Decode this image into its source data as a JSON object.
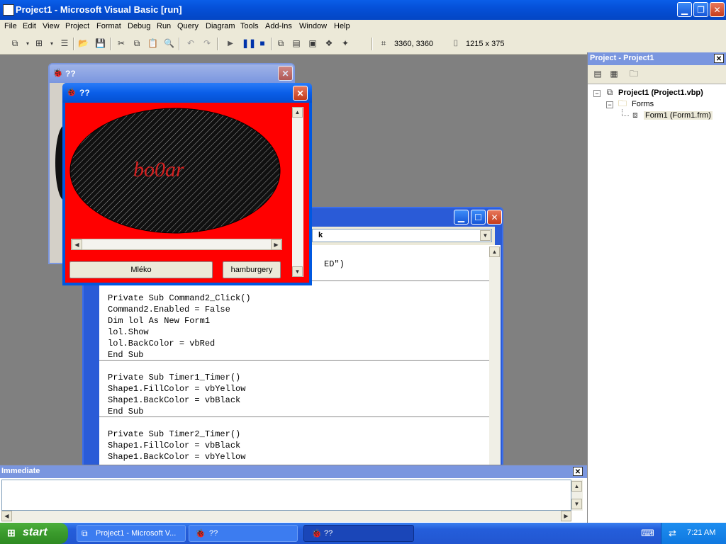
{
  "window": {
    "title": "Project1 - Microsoft Visual Basic [run]"
  },
  "menu": {
    "items": [
      "File",
      "Edit",
      "View",
      "Project",
      "Format",
      "Debug",
      "Run",
      "Query",
      "Diagram",
      "Tools",
      "Add-Ins",
      "Window",
      "Help"
    ]
  },
  "toolbar": {
    "position_readout": "3360, 3360",
    "size_readout": "1215 x 375"
  },
  "project_panel": {
    "title": "Project - Project1",
    "root": "Project1 (Project1.vbp)",
    "folder": "Forms",
    "form": "Form1 (Form1.frm)"
  },
  "back_form": {
    "title": "??"
  },
  "front_form": {
    "title": "??",
    "ellipse_text": "bo0ar",
    "button1": "Mléko",
    "button2": "hamburgery"
  },
  "code_window": {
    "procedure_fragment": "k",
    "partial_line": "ED\")",
    "lines": [
      "Private Sub Command2_Click()",
      "Command2.Enabled = False",
      "Dim lol As New Form1",
      "lol.Show",
      "lol.BackColor = vbRed",
      "End Sub",
      "",
      "Private Sub Timer1_Timer()",
      "Shape1.FillColor = vbYellow",
      "Shape1.BackColor = vbBlack",
      "End Sub",
      "",
      "Private Sub Timer2_Timer()",
      "Shape1.FillColor = vbBlack",
      "Shape1.BackColor = vbYellow"
    ]
  },
  "immediate": {
    "title": "Immediate"
  },
  "taskbar": {
    "start": "start",
    "tasks": [
      "Project1 - Microsoft V...",
      "??",
      "??"
    ],
    "clock": "7:21 AM"
  },
  "colors": {
    "xp_blue": "#0a5ee8",
    "form_red": "#ff0000",
    "panel_title": "#7a96df",
    "start_green": "#3a9a2c"
  }
}
